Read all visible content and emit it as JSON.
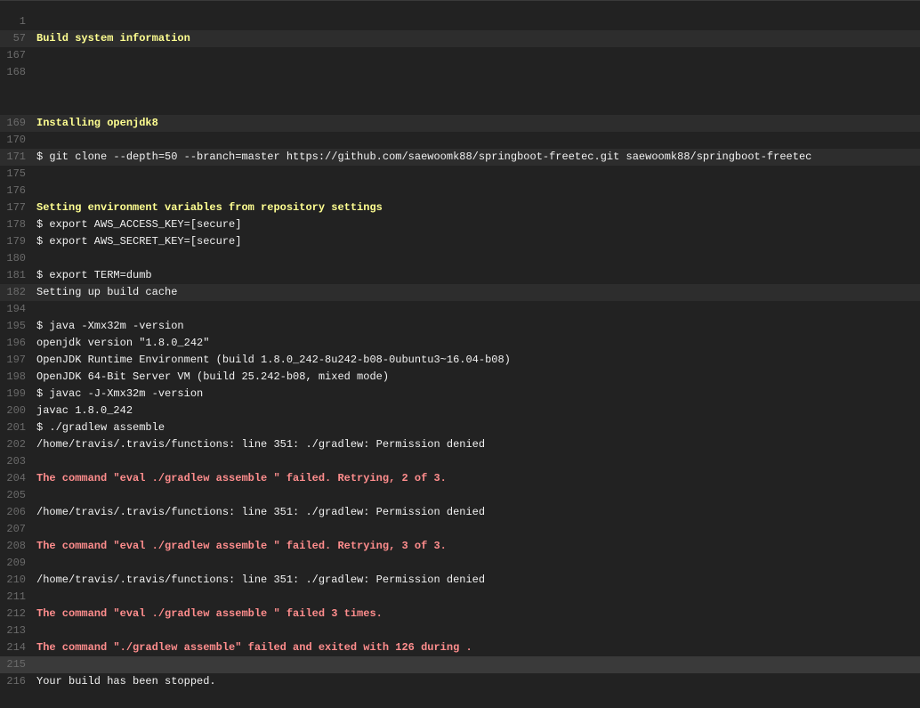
{
  "log": {
    "lines": [
      {
        "n": "1",
        "text": ""
      },
      {
        "n": "57",
        "text": "Build system information"
      },
      {
        "n": "167",
        "text": ""
      },
      {
        "n": "168",
        "text": ""
      },
      {
        "n": "169",
        "text": "Installing openjdk8"
      },
      {
        "n": "170",
        "text": ""
      },
      {
        "n": "171",
        "text": "$ git clone --depth=50 --branch=master https://github.com/saewoomk88/springboot-freetec.git saewoomk88/springboot-freetec"
      },
      {
        "n": "175",
        "text": ""
      },
      {
        "n": "176",
        "text": ""
      },
      {
        "n": "177",
        "text": "Setting environment variables from repository settings"
      },
      {
        "n": "178",
        "text": "$ export AWS_ACCESS_KEY=[secure]"
      },
      {
        "n": "179",
        "text": "$ export AWS_SECRET_KEY=[secure]"
      },
      {
        "n": "180",
        "text": ""
      },
      {
        "n": "181",
        "text": "$ export TERM=dumb"
      },
      {
        "n": "182",
        "text": "Setting up build cache"
      },
      {
        "n": "194",
        "text": ""
      },
      {
        "n": "195",
        "text": "$ java -Xmx32m -version"
      },
      {
        "n": "196",
        "text": "openjdk version \"1.8.0_242\""
      },
      {
        "n": "197",
        "text": "OpenJDK Runtime Environment (build 1.8.0_242-8u242-b08-0ubuntu3~16.04-b08)"
      },
      {
        "n": "198",
        "text": "OpenJDK 64-Bit Server VM (build 25.242-b08, mixed mode)"
      },
      {
        "n": "199",
        "text": "$ javac -J-Xmx32m -version"
      },
      {
        "n": "200",
        "text": "javac 1.8.0_242"
      },
      {
        "n": "201",
        "text": "$ ./gradlew assemble"
      },
      {
        "n": "202",
        "text": "/home/travis/.travis/functions: line 351: ./gradlew: Permission denied"
      },
      {
        "n": "203",
        "text": ""
      },
      {
        "n": "204",
        "text": "The command \"eval ./gradlew assemble \" failed. Retrying, 2 of 3."
      },
      {
        "n": "205",
        "text": ""
      },
      {
        "n": "206",
        "text": "/home/travis/.travis/functions: line 351: ./gradlew: Permission denied"
      },
      {
        "n": "207",
        "text": ""
      },
      {
        "n": "208",
        "text": "The command \"eval ./gradlew assemble \" failed. Retrying, 3 of 3."
      },
      {
        "n": "209",
        "text": ""
      },
      {
        "n": "210",
        "text": "/home/travis/.travis/functions: line 351: ./gradlew: Permission denied"
      },
      {
        "n": "211",
        "text": ""
      },
      {
        "n": "212",
        "text": "The command \"eval ./gradlew assemble \" failed 3 times."
      },
      {
        "n": "213",
        "text": ""
      },
      {
        "n": "214",
        "text": "The command \"./gradlew assemble\" failed and exited with 126 during ."
      },
      {
        "n": "215",
        "text": ""
      },
      {
        "n": "216",
        "text": "Your build has been stopped."
      }
    ]
  },
  "colors": {
    "background": "#222222",
    "fold_background": "#2d2d2d",
    "highlight_background": "#3a3a3a",
    "line_number": "#6a6a6a",
    "text": "#f1f1f1",
    "yellow_heading": "#ffff91",
    "red_error": "#ff8d8d"
  }
}
